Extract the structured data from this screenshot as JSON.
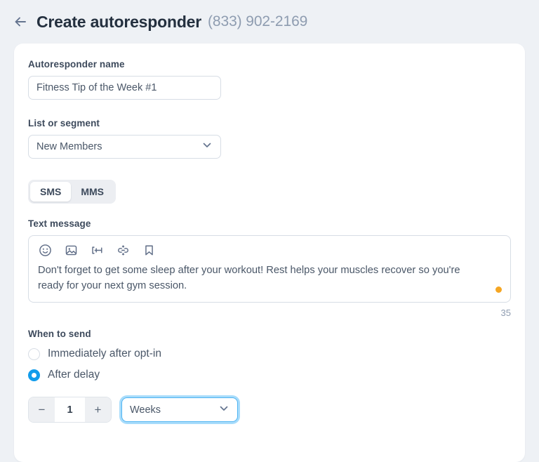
{
  "header": {
    "back_icon": "arrow-left-icon",
    "title": "Create autoresponder",
    "phone": "(833) 902-2169"
  },
  "form": {
    "name_field": {
      "label": "Autoresponder name",
      "value": "Fitness Tip of the Week #1",
      "placeholder": "Autoresponder name"
    },
    "list_field": {
      "label": "List or segment",
      "value": "New Members",
      "chevron_icon": "chevron-down-icon"
    },
    "message_type": {
      "options": [
        "SMS",
        "MMS"
      ],
      "selected": "SMS"
    },
    "message": {
      "label": "Text message",
      "toolbar_icons": [
        "emoji-icon",
        "image-icon",
        "merge-field-icon",
        "link-icon",
        "template-icon"
      ],
      "body": "Don't forget to get some sleep after your workout! Rest helps your muscles recover so you're ready for your next gym session.",
      "status_dot": "segment-status-dot",
      "char_count": "35"
    },
    "when_to_send": {
      "label": "When to send",
      "options": [
        {
          "label": "Immediately after opt-in",
          "selected": false
        },
        {
          "label": "After delay",
          "selected": true
        }
      ]
    },
    "delay": {
      "decrement_label": "−",
      "value": "1",
      "increment_label": "+",
      "unit": "Weeks",
      "unit_chevron_icon": "chevron-down-icon"
    }
  },
  "colors": {
    "page_background": "#eef1f5",
    "card_background": "#ffffff",
    "accent_blue": "#119ceb",
    "focus_ring": "#a8dcfb",
    "status_orange": "#f5a623",
    "text_primary": "#3d4a5c",
    "text_muted": "#8e9cb0"
  }
}
